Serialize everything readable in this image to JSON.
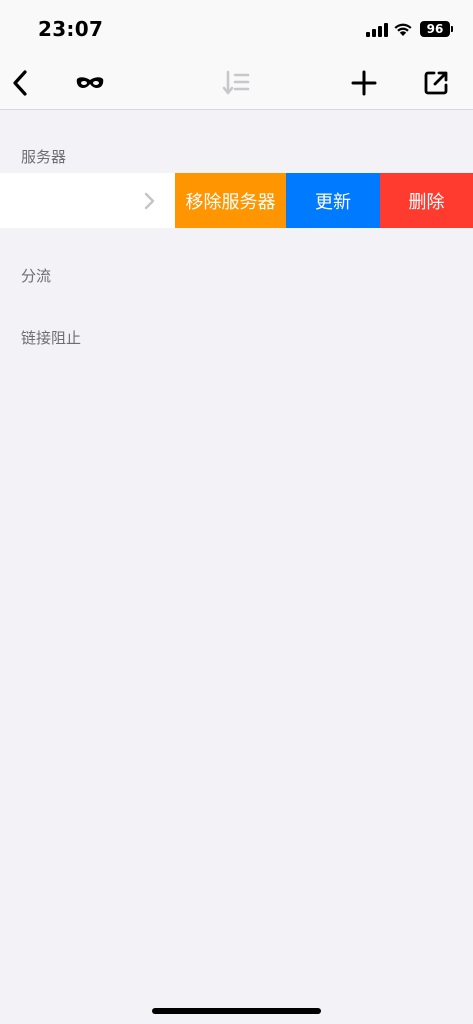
{
  "status_bar": {
    "time": "23:07",
    "battery": "96"
  },
  "nav": {
    "back_icon": "chevron-left-icon",
    "incognito_icon": "mask-icon",
    "sort_icon": "sort-icon",
    "add_icon": "plus-icon",
    "share_icon": "external-link-icon"
  },
  "sections": {
    "servers": {
      "title": "服务器"
    },
    "routing": {
      "title": "分流"
    },
    "block": {
      "title": "链接阻止"
    }
  },
  "server_row": {
    "actions": {
      "remove": "移除服务器",
      "update": "更新",
      "delete": "删除"
    }
  },
  "colors": {
    "remove": "#ff9500",
    "update": "#007aff",
    "delete": "#ff3b30",
    "background": "#f2f2f7"
  }
}
